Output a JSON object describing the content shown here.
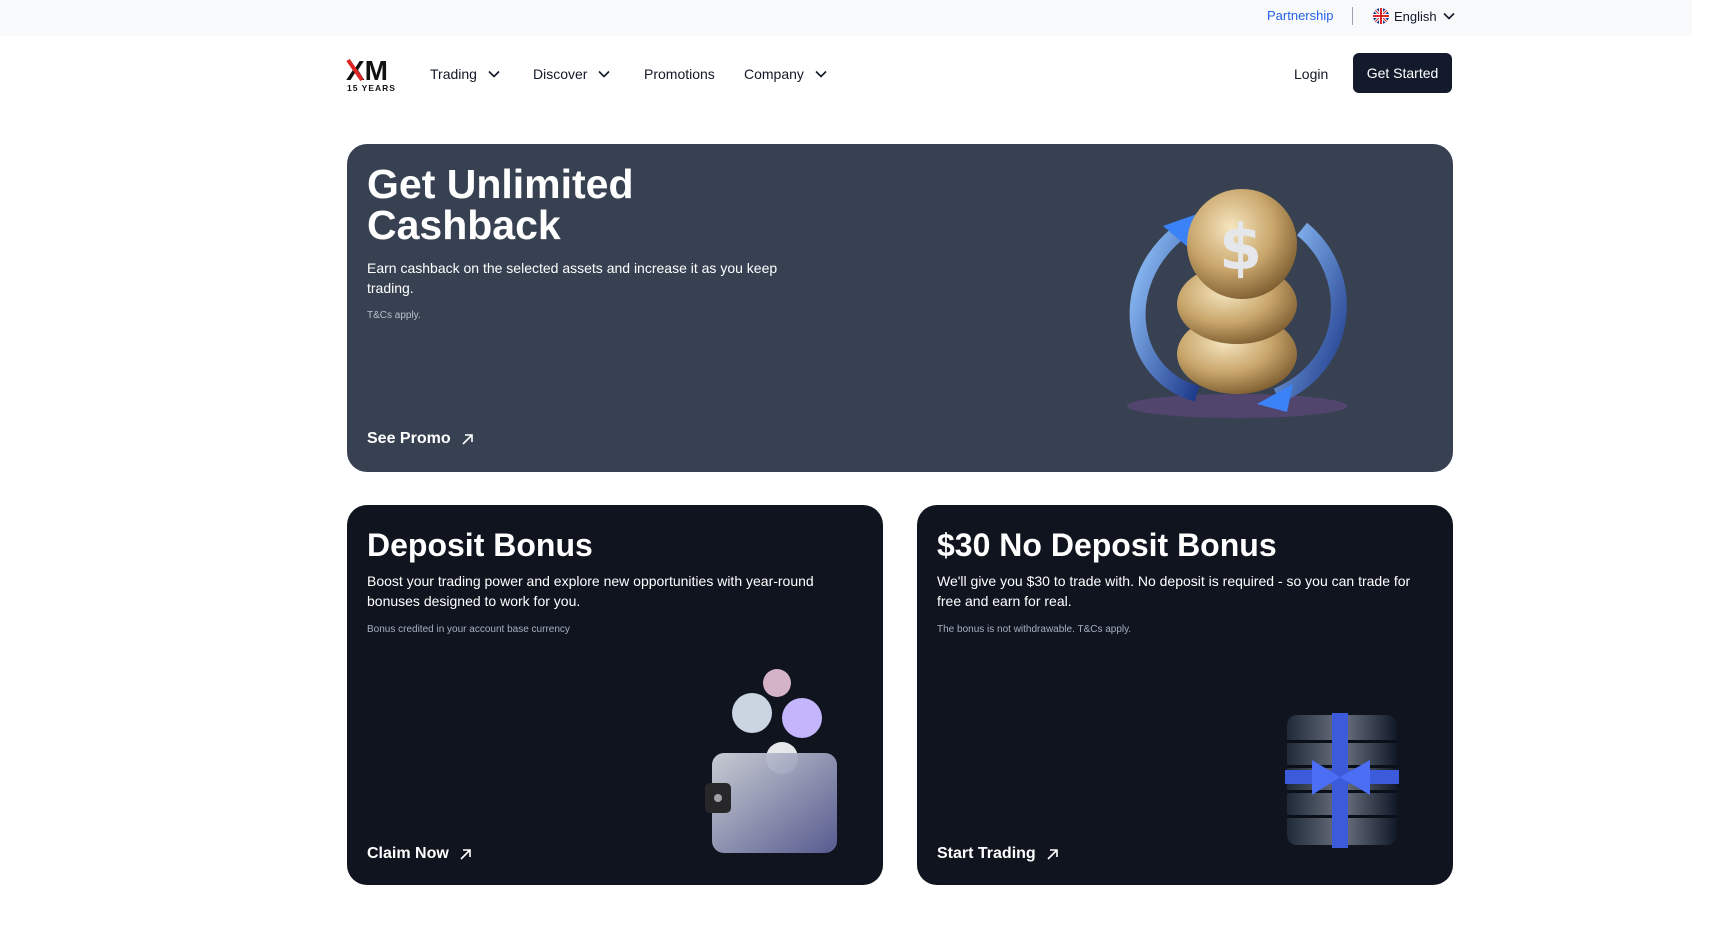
{
  "topbar": {
    "partnership": "Partnership",
    "language": "English"
  },
  "logo": {
    "brand": "XM",
    "tagline": "15 YEARS"
  },
  "nav": {
    "items": [
      {
        "label": "Trading",
        "has_dropdown": true
      },
      {
        "label": "Discover",
        "has_dropdown": true
      },
      {
        "label": "Promotions",
        "has_dropdown": false
      },
      {
        "label": "Company",
        "has_dropdown": true
      }
    ],
    "login": "Login",
    "get_started": "Get Started"
  },
  "hero": {
    "title": "Get Unlimited Cashback",
    "description": "Earn cashback on the selected assets and increase it as you keep trading.",
    "note": "T&Cs apply.",
    "link": "See Promo"
  },
  "deposit": {
    "title": "Deposit Bonus",
    "description": "Boost your trading power and explore new opportunities with year-round bonuses designed to work for you.",
    "note": "Bonus credited in your account base currency",
    "link": "Claim Now"
  },
  "no_deposit": {
    "title": "$30 No Deposit Bonus",
    "description": "We'll give you $30 to trade with. No deposit is required - so you can trade for free and earn for real.",
    "note": "The bonus is not withdrawable. T&Cs apply.",
    "link": "Start Trading"
  },
  "icons": [
    "uk-flag-icon",
    "chevron-down-icon",
    "arrow-up-right-icon",
    "coins-cashback-illustration",
    "wallet-coins-illustration",
    "coin-stack-gift-illustration"
  ],
  "colors": {
    "hero_bg": "#374151",
    "card_bg": "#0f141f",
    "cta_bg": "#131a2b",
    "link_blue": "#2563eb"
  }
}
